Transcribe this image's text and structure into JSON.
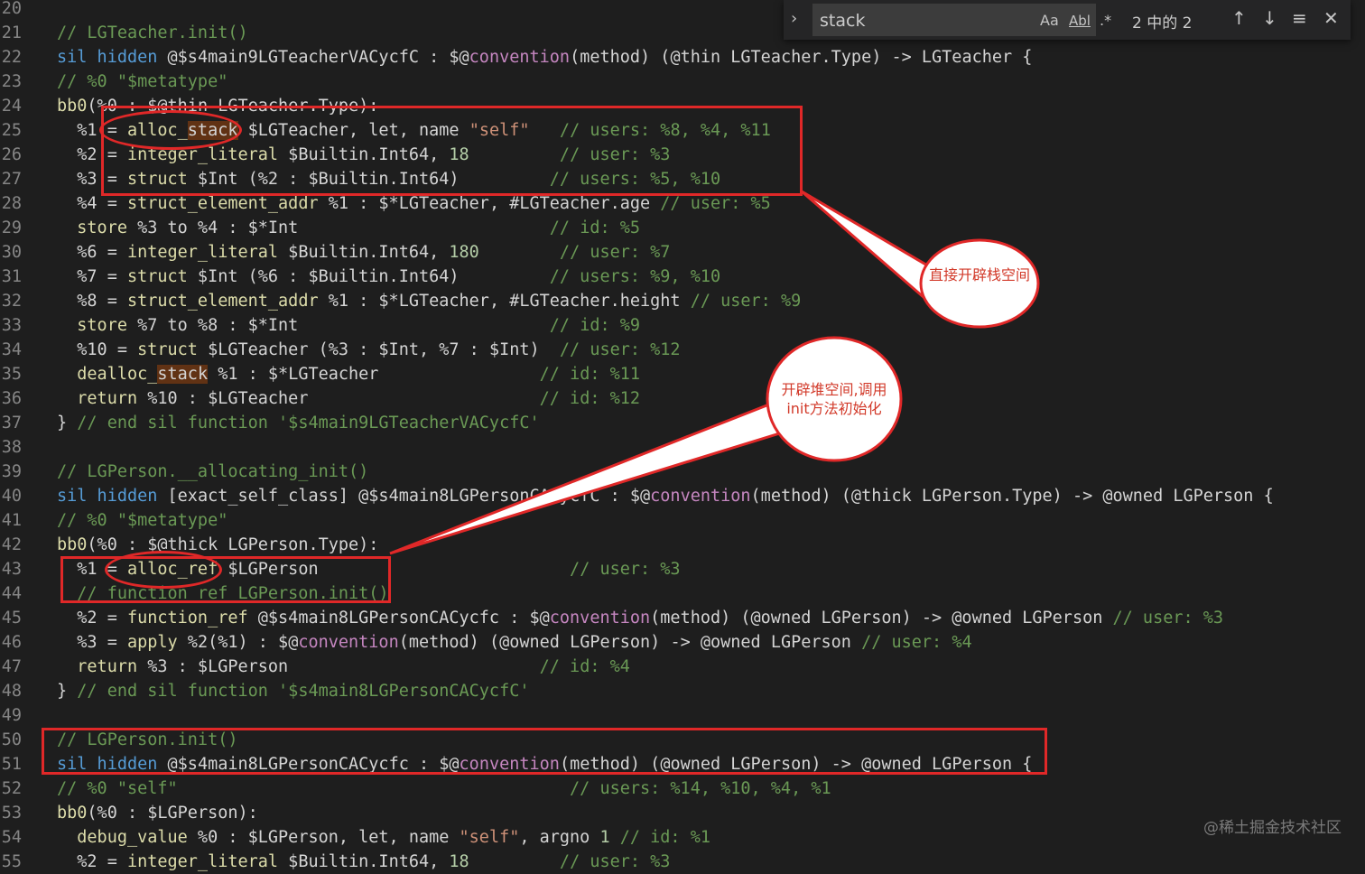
{
  "find_widget": {
    "query": "stack",
    "match_case_label": "Aa",
    "whole_word_label": "Abl",
    "regex_label": ".*",
    "result_count": "2 中的 2",
    "icons": [
      "chevron-right-icon",
      "arrow-up-icon",
      "arrow-down-icon",
      "selection-icon",
      "close-icon"
    ]
  },
  "lines": [
    {
      "n": "20",
      "t": []
    },
    {
      "n": "21",
      "t": [
        {
          "c": "c",
          "s": "// LGTeacher.init()"
        }
      ]
    },
    {
      "n": "22",
      "t": [
        {
          "c": "k",
          "s": "sil hidden "
        },
        {
          "c": "p",
          "s": "@$s4main9LGTeacherVACycfC : $@"
        },
        {
          "c": "a",
          "s": "convention"
        },
        {
          "c": "p",
          "s": "(method) (@thin LGTeacher.Type) -> LGTeacher {"
        }
      ]
    },
    {
      "n": "23",
      "t": [
        {
          "c": "c",
          "s": "// %0 \"$metatype\""
        }
      ]
    },
    {
      "n": "24",
      "t": [
        {
          "c": "f",
          "s": "bb0"
        },
        {
          "c": "p",
          "s": "(%0 : $@thin LGTeacher.Type):"
        }
      ]
    },
    {
      "n": "25",
      "t": [
        {
          "c": "p",
          "s": "  %1 = "
        },
        {
          "c": "f",
          "s": "alloc_"
        },
        {
          "c": "h",
          "s": "stack"
        },
        {
          "c": "p",
          "s": " $LGTeacher, let, name "
        },
        {
          "c": "s",
          "s": "\"self\""
        },
        {
          "c": "c",
          "s": "   // users: %8, %4, %11"
        }
      ]
    },
    {
      "n": "26",
      "t": [
        {
          "c": "p",
          "s": "  %2 = "
        },
        {
          "c": "f",
          "s": "integer_literal"
        },
        {
          "c": "p",
          "s": " $Builtin.Int64, "
        },
        {
          "c": "n",
          "s": "18"
        },
        {
          "c": "c",
          "s": "         // user: %3"
        }
      ]
    },
    {
      "n": "27",
      "t": [
        {
          "c": "p",
          "s": "  %3 = "
        },
        {
          "c": "f",
          "s": "struct"
        },
        {
          "c": "p",
          "s": " $Int (%2 : $Builtin.Int64)"
        },
        {
          "c": "c",
          "s": "         // users: %5, %10"
        }
      ]
    },
    {
      "n": "28",
      "t": [
        {
          "c": "p",
          "s": "  %4 = "
        },
        {
          "c": "f",
          "s": "struct_element_addr"
        },
        {
          "c": "p",
          "s": " %1 : $*LGTeacher, #LGTeacher.age "
        },
        {
          "c": "c",
          "s": "// user: %5"
        }
      ]
    },
    {
      "n": "29",
      "t": [
        {
          "c": "f",
          "s": "  store"
        },
        {
          "c": "p",
          "s": " %3 to %4 : $*Int"
        },
        {
          "c": "c",
          "s": "                         // id: %5"
        }
      ]
    },
    {
      "n": "30",
      "t": [
        {
          "c": "p",
          "s": "  %6 = "
        },
        {
          "c": "f",
          "s": "integer_literal"
        },
        {
          "c": "p",
          "s": " $Builtin.Int64, "
        },
        {
          "c": "n",
          "s": "180"
        },
        {
          "c": "c",
          "s": "        // user: %7"
        }
      ]
    },
    {
      "n": "31",
      "t": [
        {
          "c": "p",
          "s": "  %7 = "
        },
        {
          "c": "f",
          "s": "struct"
        },
        {
          "c": "p",
          "s": " $Int (%6 : $Builtin.Int64)"
        },
        {
          "c": "c",
          "s": "         // users: %9, %10"
        }
      ]
    },
    {
      "n": "32",
      "t": [
        {
          "c": "p",
          "s": "  %8 = "
        },
        {
          "c": "f",
          "s": "struct_element_addr"
        },
        {
          "c": "p",
          "s": " %1 : $*LGTeacher, #LGTeacher.height "
        },
        {
          "c": "c",
          "s": "// user: %9"
        }
      ]
    },
    {
      "n": "33",
      "t": [
        {
          "c": "f",
          "s": "  store"
        },
        {
          "c": "p",
          "s": " %7 to %8 : $*Int"
        },
        {
          "c": "c",
          "s": "                         // id: %9"
        }
      ]
    },
    {
      "n": "34",
      "t": [
        {
          "c": "p",
          "s": "  %10 = "
        },
        {
          "c": "f",
          "s": "struct"
        },
        {
          "c": "p",
          "s": " $LGTeacher (%3 : $Int, %7 : $Int)"
        },
        {
          "c": "c",
          "s": "  // user: %12"
        }
      ]
    },
    {
      "n": "35",
      "t": [
        {
          "c": "f",
          "s": "  dealloc_"
        },
        {
          "c": "h",
          "s": "stack"
        },
        {
          "c": "p",
          "s": " %1 : $*LGTeacher"
        },
        {
          "c": "c",
          "s": "                // id: %11"
        }
      ]
    },
    {
      "n": "36",
      "t": [
        {
          "c": "f",
          "s": "  return"
        },
        {
          "c": "p",
          "s": " %10 : $LGTeacher"
        },
        {
          "c": "c",
          "s": "                       // id: %12"
        }
      ]
    },
    {
      "n": "37",
      "t": [
        {
          "c": "p",
          "s": "} "
        },
        {
          "c": "c",
          "s": "// end sil function '$s4main9LGTeacherVACycfC'"
        }
      ]
    },
    {
      "n": "38",
      "t": []
    },
    {
      "n": "39",
      "t": [
        {
          "c": "c",
          "s": "// LGPerson.__allocating_init()"
        }
      ]
    },
    {
      "n": "40",
      "t": [
        {
          "c": "k",
          "s": "sil hidden "
        },
        {
          "c": "p",
          "s": "[exact_self_class] @$s4main8LGPersonCACycfC : $@"
        },
        {
          "c": "a",
          "s": "convention"
        },
        {
          "c": "p",
          "s": "(method) (@thick LGPerson.Type) -> @owned LGPerson {"
        }
      ]
    },
    {
      "n": "41",
      "t": [
        {
          "c": "c",
          "s": "// %0 \"$metatype\""
        }
      ]
    },
    {
      "n": "42",
      "t": [
        {
          "c": "f",
          "s": "bb0"
        },
        {
          "c": "p",
          "s": "(%0 : $@thick LGPerson.Type):"
        }
      ]
    },
    {
      "n": "43",
      "t": [
        {
          "c": "p",
          "s": "  %1 = "
        },
        {
          "c": "f",
          "s": "alloc_ref"
        },
        {
          "c": "p",
          "s": " $LGPerson"
        },
        {
          "c": "c",
          "s": "                         // user: %3"
        }
      ]
    },
    {
      "n": "44",
      "t": [
        {
          "c": "c",
          "s": "  // function_ref LGPerson.init()"
        }
      ]
    },
    {
      "n": "45",
      "t": [
        {
          "c": "p",
          "s": "  %2 = "
        },
        {
          "c": "f",
          "s": "function_ref"
        },
        {
          "c": "p",
          "s": " @$s4main8LGPersonCACycfc : $@"
        },
        {
          "c": "a",
          "s": "convention"
        },
        {
          "c": "p",
          "s": "(method) (@owned LGPerson) -> @owned LGPerson "
        },
        {
          "c": "c",
          "s": "// user: %3"
        }
      ]
    },
    {
      "n": "46",
      "t": [
        {
          "c": "p",
          "s": "  %3 = "
        },
        {
          "c": "f",
          "s": "apply"
        },
        {
          "c": "p",
          "s": " %2(%1) : $@"
        },
        {
          "c": "a",
          "s": "convention"
        },
        {
          "c": "p",
          "s": "(method) (@owned LGPerson) -> @owned LGPerson "
        },
        {
          "c": "c",
          "s": "// user: %4"
        }
      ]
    },
    {
      "n": "47",
      "t": [
        {
          "c": "f",
          "s": "  return"
        },
        {
          "c": "p",
          "s": " %3 : $LGPerson"
        },
        {
          "c": "c",
          "s": "                         // id: %4"
        }
      ]
    },
    {
      "n": "48",
      "t": [
        {
          "c": "p",
          "s": "} "
        },
        {
          "c": "c",
          "s": "// end sil function '$s4main8LGPersonCACycfC'"
        }
      ]
    },
    {
      "n": "49",
      "t": []
    },
    {
      "n": "50",
      "t": [
        {
          "c": "c",
          "s": "// LGPerson.init()"
        }
      ]
    },
    {
      "n": "51",
      "t": [
        {
          "c": "k",
          "s": "sil hidden "
        },
        {
          "c": "p",
          "s": "@$s4main8LGPersonCACycfc : $@"
        },
        {
          "c": "a",
          "s": "convention"
        },
        {
          "c": "p",
          "s": "(method) (@owned LGPerson) -> @owned LGPerson {"
        }
      ]
    },
    {
      "n": "52",
      "t": [
        {
          "c": "c",
          "s": "// %0 \"self\"                                       // users: %14, %10, %4, %1"
        }
      ]
    },
    {
      "n": "53",
      "t": [
        {
          "c": "f",
          "s": "bb0"
        },
        {
          "c": "p",
          "s": "(%0 : $LGPerson):"
        }
      ]
    },
    {
      "n": "54",
      "t": [
        {
          "c": "f",
          "s": "  debug_value"
        },
        {
          "c": "p",
          "s": " %0 : $LGPerson, let, name "
        },
        {
          "c": "s",
          "s": "\"self\""
        },
        {
          "c": "p",
          "s": ", argno "
        },
        {
          "c": "n",
          "s": "1"
        },
        {
          "c": "c",
          "s": " // id: %1"
        }
      ]
    },
    {
      "n": "55",
      "t": [
        {
          "c": "p",
          "s": "  %2 = "
        },
        {
          "c": "f",
          "s": "integer_literal"
        },
        {
          "c": "p",
          "s": " $Builtin.Int64, "
        },
        {
          "c": "n",
          "s": "18"
        },
        {
          "c": "c",
          "s": "         // user: %3"
        }
      ]
    }
  ],
  "annotations": {
    "callout_stack": "直接开辟栈空间",
    "callout_heap": "开辟堆空间,调用init方法初始化"
  },
  "watermark": "@稀土掘金技术社区",
  "colors": {
    "background": "#1e1e1e",
    "annotation_red": "#e02828",
    "match_highlight": "#613214"
  }
}
